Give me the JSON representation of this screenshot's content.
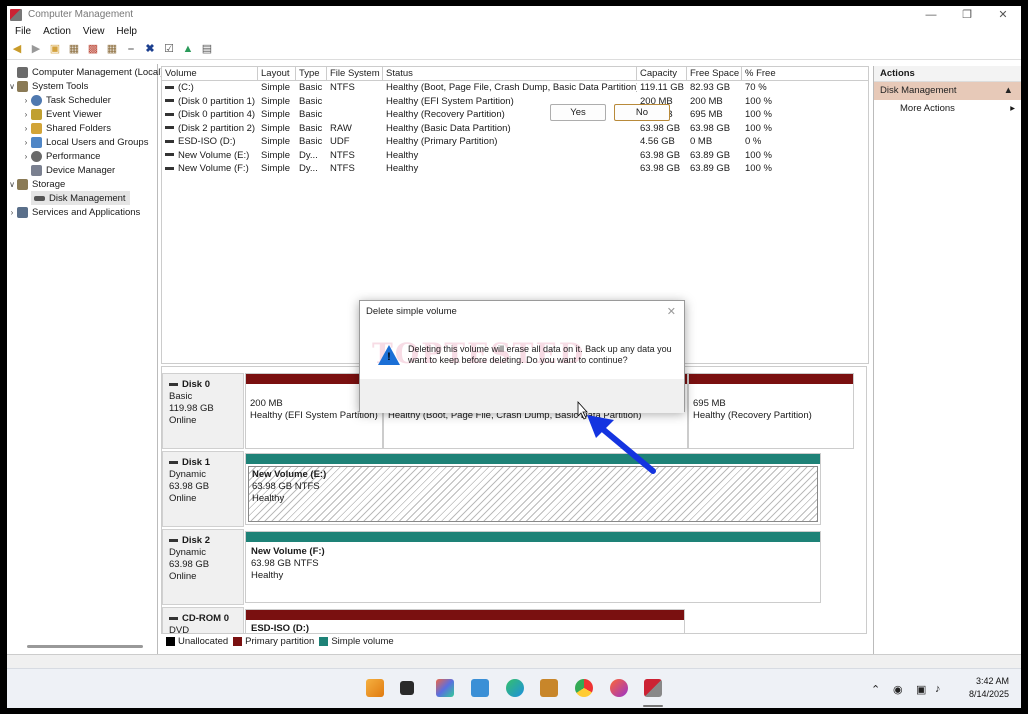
{
  "window": {
    "title": "Computer Management"
  },
  "menu": [
    "File",
    "Action",
    "View",
    "Help"
  ],
  "tree": [
    {
      "label": "Computer Management (Local)",
      "level": 0,
      "chev": "",
      "color": "#6b6b6b"
    },
    {
      "label": "System Tools",
      "level": 1,
      "chev": "v",
      "color": "#8a7a55"
    },
    {
      "label": "Task Scheduler",
      "level": 2,
      "chev": ">",
      "color": "#4f79b0"
    },
    {
      "label": "Event Viewer",
      "level": 2,
      "chev": ">",
      "color": "#c0a030"
    },
    {
      "label": "Shared Folders",
      "level": 2,
      "chev": ">",
      "color": "#d2a437"
    },
    {
      "label": "Local Users and Groups",
      "level": 2,
      "chev": ">",
      "color": "#4f86c6"
    },
    {
      "label": "Performance",
      "level": 2,
      "chev": ">",
      "color": "#6a6a6a"
    },
    {
      "label": "Device Manager",
      "level": 2,
      "chev": "",
      "color": "#7a8090"
    },
    {
      "label": "Storage",
      "level": 1,
      "chev": "v",
      "color": "#8a7a55"
    },
    {
      "label": "Disk Management",
      "level": 2,
      "chev": "",
      "color": "#555555",
      "selected": true
    },
    {
      "label": "Services and Applications",
      "level": 1,
      "chev": ">",
      "color": "#5a6f8a"
    }
  ],
  "volumes": {
    "headers": [
      "Volume",
      "Layout",
      "Type",
      "File System",
      "Status",
      "Capacity",
      "Free Space",
      "% Free"
    ],
    "rows": [
      [
        "(C:)",
        "Simple",
        "Basic",
        "NTFS",
        "Healthy (Boot, Page File, Crash Dump, Basic Data Partition)",
        "119.11 GB",
        "82.93 GB",
        "70 %"
      ],
      [
        "(Disk 0 partition 1)",
        "Simple",
        "Basic",
        "",
        "Healthy (EFI System Partition)",
        "200 MB",
        "200 MB",
        "100 %"
      ],
      [
        "(Disk 0 partition 4)",
        "Simple",
        "Basic",
        "",
        "Healthy (Recovery Partition)",
        "695 MB",
        "695 MB",
        "100 %"
      ],
      [
        "(Disk 2 partition 2)",
        "Simple",
        "Basic",
        "RAW",
        "Healthy (Basic Data Partition)",
        "63.98 GB",
        "63.98 GB",
        "100 %"
      ],
      [
        "ESD-ISO (D:)",
        "Simple",
        "Basic",
        "UDF",
        "Healthy (Primary Partition)",
        "4.56 GB",
        "0 MB",
        "0 %"
      ],
      [
        "New Volume (E:)",
        "Simple",
        "Dy...",
        "NTFS",
        "Healthy",
        "63.98 GB",
        "63.89 GB",
        "100 %"
      ],
      [
        "New Volume (F:)",
        "Simple",
        "Dy...",
        "NTFS",
        "Healthy",
        "63.98 GB",
        "63.89 GB",
        "100 %"
      ]
    ]
  },
  "disks": {
    "disk0": {
      "name": "Disk 0",
      "type": "Basic",
      "size": "119.98 GB",
      "state": "Online",
      "p1": {
        "size": "200 MB",
        "status": "Healthy (EFI System Partition)"
      },
      "p2": {
        "status": "Healthy (Boot, Page File, Crash Dump, Basic Data Partition)"
      },
      "p3": {
        "size": "695 MB",
        "status": "Healthy (Recovery Partition)"
      }
    },
    "disk1": {
      "name": "Disk 1",
      "type": "Dynamic",
      "size": "63.98 GB",
      "state": "Online",
      "vol": {
        "name": "New Volume  (E:)",
        "fs": "63.98 GB NTFS",
        "status": "Healthy"
      }
    },
    "disk2": {
      "name": "Disk 2",
      "type": "Dynamic",
      "size": "63.98 GB",
      "state": "Online",
      "vol": {
        "name": "New Volume  (F:)",
        "fs": "63.98 GB NTFS",
        "status": "Healthy"
      }
    },
    "cdrom": {
      "name": "CD-ROM 0",
      "type": "DVD",
      "vol": {
        "name": "ESD-ISO  (D:)"
      }
    }
  },
  "legend": [
    {
      "label": "Unallocated",
      "color": "#000000"
    },
    {
      "label": "Primary partition",
      "color": "#7a1010"
    },
    {
      "label": "Simple volume",
      "color": "#1e8277"
    }
  ],
  "actions": {
    "header": "Actions",
    "section": "Disk Management",
    "more": "More Actions"
  },
  "dialog": {
    "title": "Delete simple volume",
    "message": "Deleting this volume will erase all data on it. Back up any data you want to keep before deleting. Do you want to continue?",
    "yes": "Yes",
    "no": "No"
  },
  "taskbar": {
    "time": "3:42 AM",
    "date": "8/14/2025"
  },
  "colors": {
    "primary": "#7a1010",
    "simple": "#1e8277",
    "arrow": "#1434e0"
  }
}
